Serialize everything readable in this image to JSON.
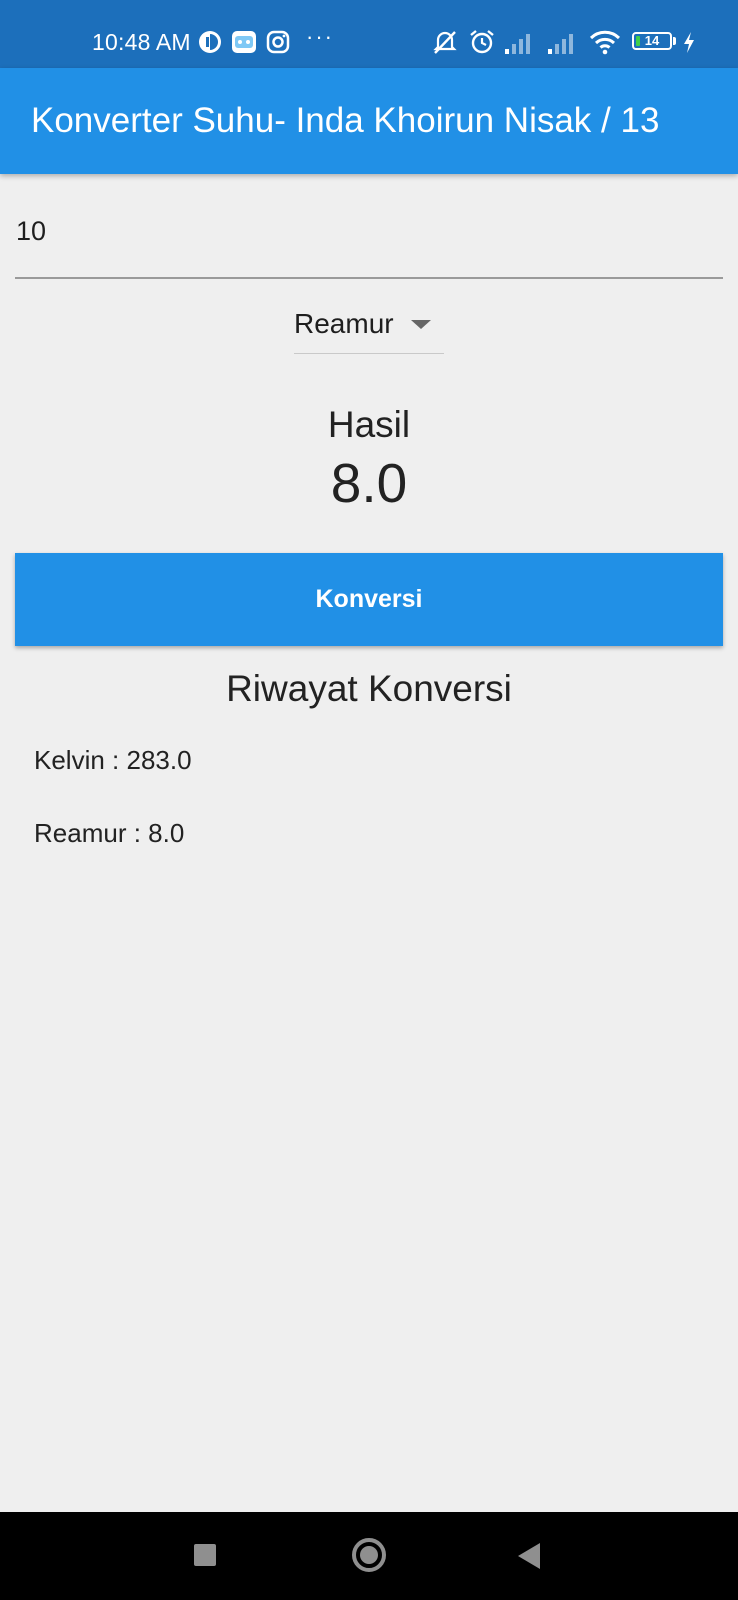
{
  "status_bar": {
    "time": "10:48 AM",
    "battery_level": 14,
    "battery_label": "14",
    "icons_left": [
      "notification-app-icon",
      "chat-app-icon",
      "instagram-icon"
    ],
    "overflow_label": "···",
    "icons_right": [
      "vibrate-off-icon",
      "alarm-icon",
      "cellular-signal-icon",
      "cellular-signal-icon",
      "wifi-icon",
      "battery-icon",
      "charging-bolt-icon"
    ]
  },
  "app_bar": {
    "title": "Konverter Suhu- Inda Khoirun Nisak / 13"
  },
  "input": {
    "value": "10"
  },
  "dropdown": {
    "selected": "Reamur"
  },
  "result": {
    "label": "Hasil",
    "value": "8.0"
  },
  "convert_button": {
    "label": "Konversi"
  },
  "history": {
    "title": "Riwayat Konversi",
    "items": [
      "Kelvin : 283.0",
      "Reamur : 8.0"
    ]
  },
  "nav_bar": {
    "buttons": [
      "recent-apps-icon",
      "home-icon",
      "back-icon"
    ]
  },
  "colors": {
    "status_bar": "#1c6fbb",
    "app_bar": "#2190e6",
    "button": "#2190e6",
    "background": "#efefef",
    "nav_bar": "#000000"
  }
}
